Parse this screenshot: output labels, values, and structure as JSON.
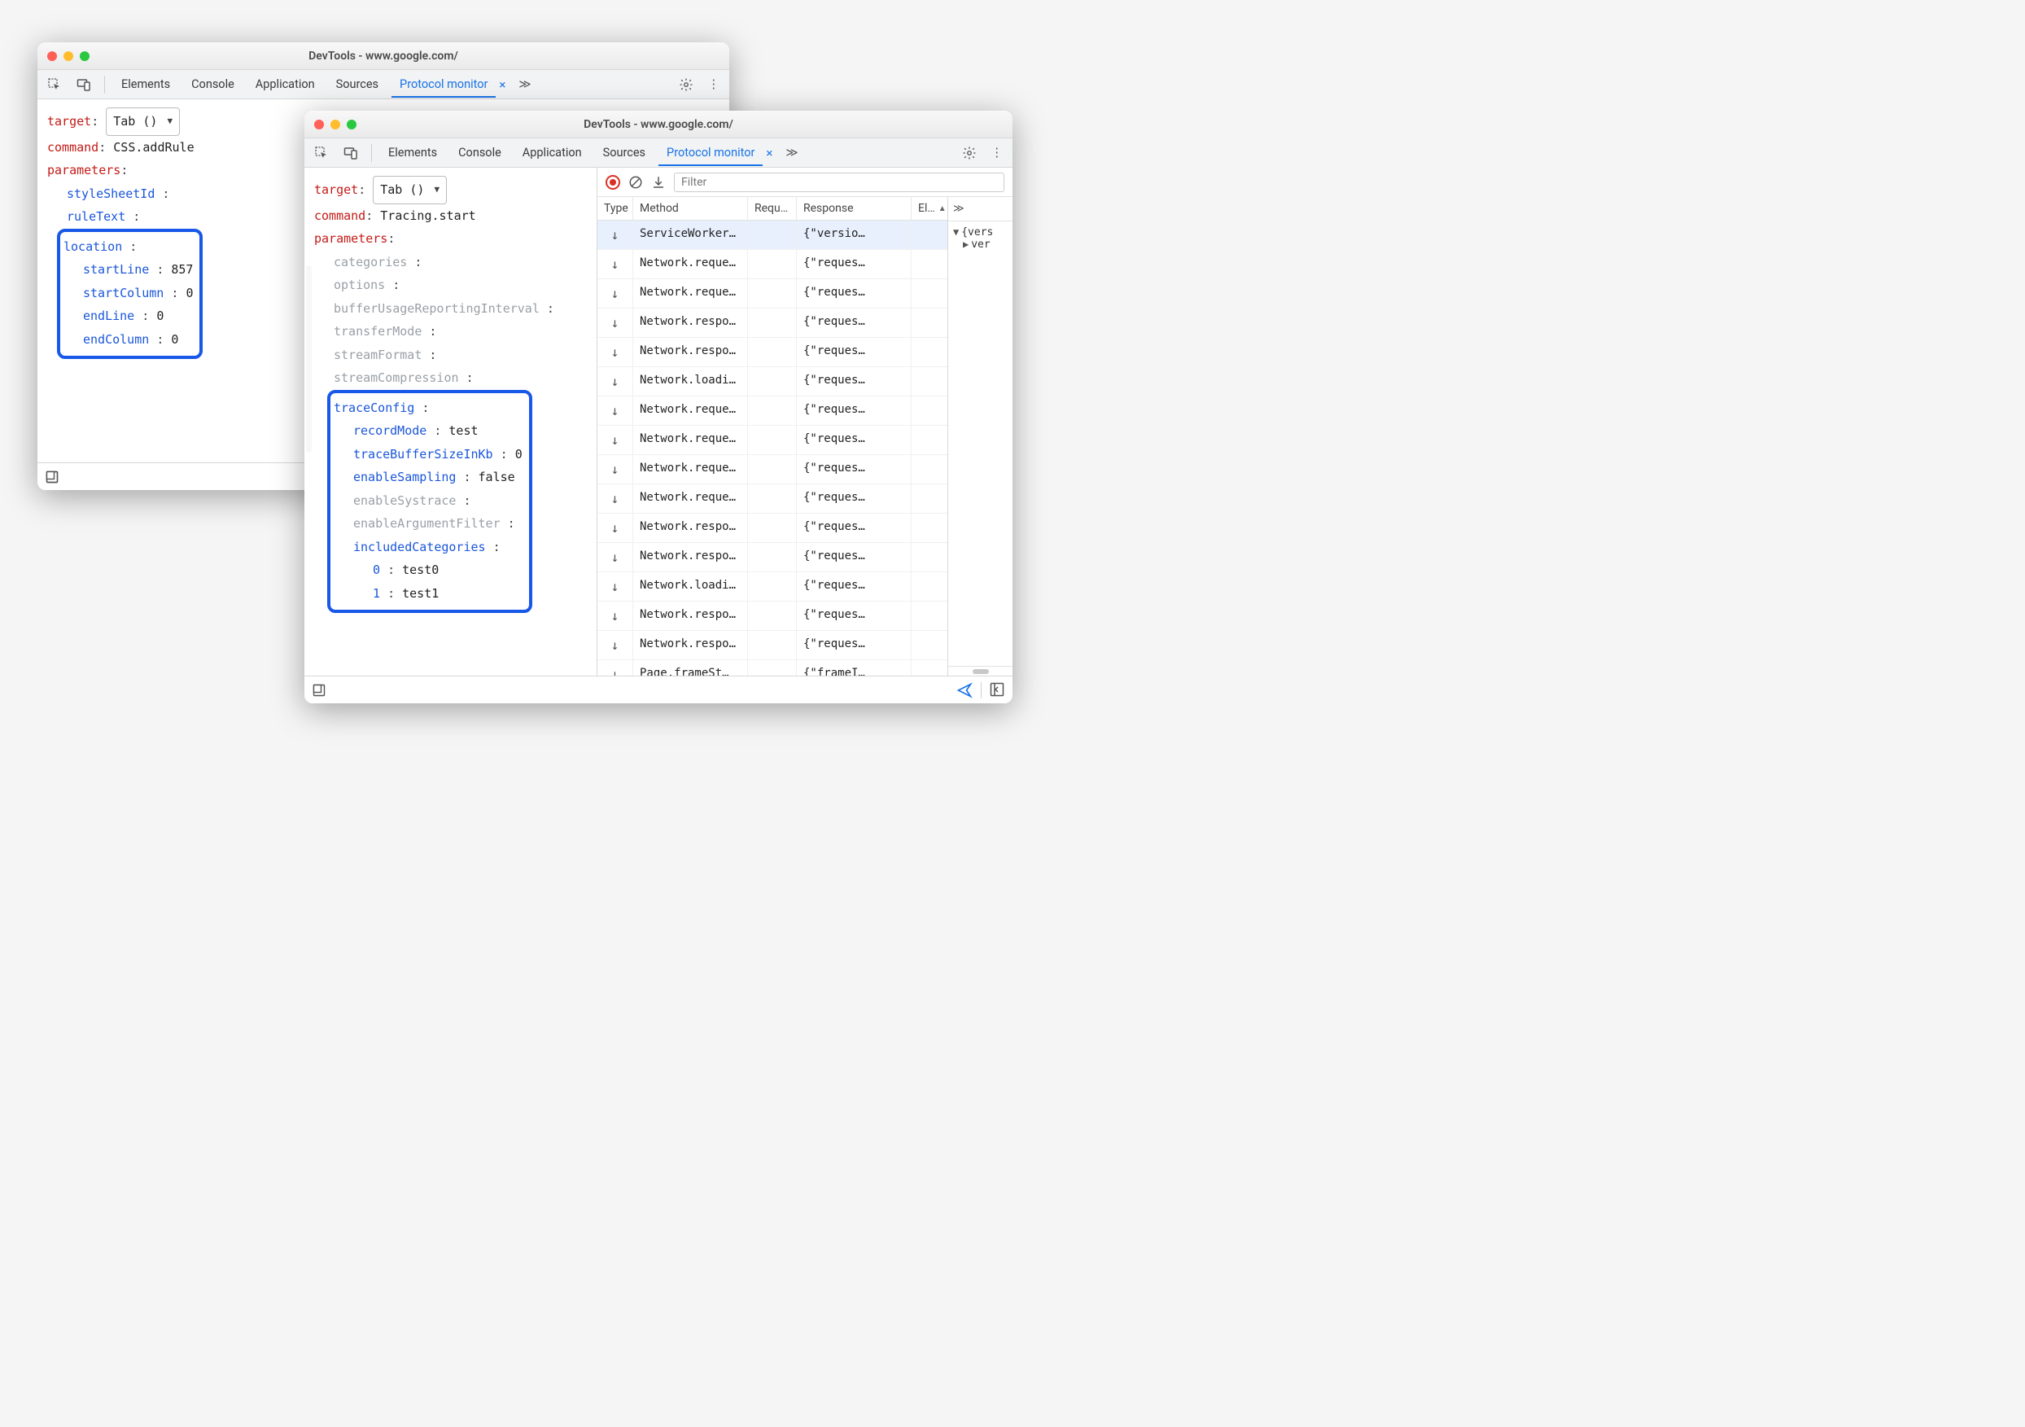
{
  "back": {
    "title": "DevTools - www.google.com/",
    "tabs": [
      "Elements",
      "Console",
      "Application",
      "Sources",
      "Protocol monitor"
    ],
    "active_tab": "Protocol monitor",
    "target_label": "target",
    "target_value": "Tab ()",
    "command_label": "command",
    "command_value": "CSS.addRule",
    "parameters_label": "parameters",
    "params": [
      {
        "key": "styleSheetId",
        "val": "<empty_string>",
        "placeholder": true,
        "blue": true
      },
      {
        "key": "ruleText",
        "val": "<empty_string>",
        "placeholder": true,
        "blue": true
      }
    ],
    "highlight_key": "location",
    "highlight_children": [
      {
        "key": "startLine",
        "val": "857"
      },
      {
        "key": "startColumn",
        "val": "0"
      },
      {
        "key": "endLine",
        "val": "0"
      },
      {
        "key": "endColumn",
        "val": "0"
      }
    ]
  },
  "front": {
    "title": "DevTools - www.google.com/",
    "tabs": [
      "Elements",
      "Console",
      "Application",
      "Sources",
      "Protocol monitor"
    ],
    "active_tab": "Protocol monitor",
    "target_label": "target",
    "target_value": "Tab ()",
    "command_label": "command",
    "command_value": "Tracing.start",
    "parameters_label": "parameters",
    "grey_params": [
      "categories",
      "options",
      "bufferUsageReportingInterval",
      "transferMode",
      "streamFormat",
      "streamCompression"
    ],
    "highlight_key": "traceConfig",
    "highlight_children": [
      {
        "key": "recordMode",
        "val": "test",
        "blue": true
      },
      {
        "key": "traceBufferSizeInKb",
        "val": "0",
        "blue": true
      },
      {
        "key": "enableSampling",
        "val": "false",
        "blue": true
      },
      {
        "key": "enableSystrace",
        "val": "",
        "grey": true
      },
      {
        "key": "enableArgumentFilter",
        "val": "",
        "grey": true
      },
      {
        "key": "includedCategories",
        "val": "",
        "blue": true,
        "children": [
          {
            "key": "0",
            "val": "test0"
          },
          {
            "key": "1",
            "val": "test1"
          }
        ]
      }
    ],
    "filter_placeholder": "Filter",
    "columns": [
      "Type",
      "Method",
      "Requ…",
      "Response",
      "El…"
    ],
    "rows": [
      {
        "method": "ServiceWorker…",
        "resp": "{\"versio…",
        "sel": true
      },
      {
        "method": "Network.reque…",
        "resp": "{\"reques…"
      },
      {
        "method": "Network.reque…",
        "resp": "{\"reques…"
      },
      {
        "method": "Network.respo…",
        "resp": "{\"reques…"
      },
      {
        "method": "Network.respo…",
        "resp": "{\"reques…"
      },
      {
        "method": "Network.loadi…",
        "resp": "{\"reques…"
      },
      {
        "method": "Network.reque…",
        "resp": "{\"reques…"
      },
      {
        "method": "Network.reque…",
        "resp": "{\"reques…"
      },
      {
        "method": "Network.reque…",
        "resp": "{\"reques…"
      },
      {
        "method": "Network.reque…",
        "resp": "{\"reques…"
      },
      {
        "method": "Network.respo…",
        "resp": "{\"reques…"
      },
      {
        "method": "Network.respo…",
        "resp": "{\"reques…"
      },
      {
        "method": "Network.loadi…",
        "resp": "{\"reques…"
      },
      {
        "method": "Network.respo…",
        "resp": "{\"reques…"
      },
      {
        "method": "Network.respo…",
        "resp": "{\"reques…"
      },
      {
        "method": "Page.frameSt…",
        "resp": "{\"frameI…"
      }
    ],
    "side_head": "≫",
    "side_body": [
      {
        "tri": "▼",
        "txt": "{vers"
      },
      {
        "tri": "▶",
        "txt": "ver",
        "indent": true
      }
    ]
  }
}
